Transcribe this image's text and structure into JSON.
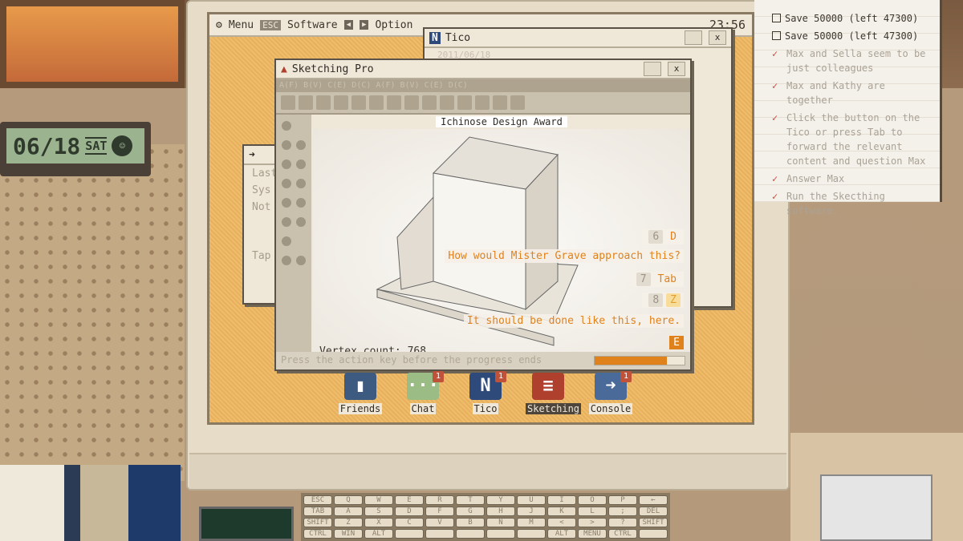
{
  "clock": {
    "date": "06/18",
    "day": "SAT"
  },
  "menubar": {
    "menu": "Menu",
    "menu_key": "ESC",
    "software": "Software",
    "option": "Option",
    "time": "23:56"
  },
  "tico": {
    "title": "Tico",
    "date": "2011/06/18"
  },
  "background_window": {
    "lines": [
      "Last",
      "Sys",
      "Not",
      "Tap"
    ]
  },
  "sketch": {
    "title": "Sketching Pro",
    "menu": "A(F) B(V) C(E) D(C) A(F) B(V) C(E) D(C)",
    "doc_title": "Ichinose Design Award",
    "vertex_label": "Vertex count:",
    "vertex_count": "768",
    "options": [
      {
        "num": "6",
        "key": "D",
        "text": "How would Mister Grave approach this?"
      },
      {
        "num": "7",
        "key": "Tab"
      },
      {
        "num": "8",
        "key": "Z",
        "text": "It should be done like this, here."
      },
      {
        "key": "E"
      }
    ],
    "status": "Press the action key before the progress ends",
    "progress_percent": 80,
    "accent": "#e0821c"
  },
  "taskbar": [
    {
      "label": "Friends",
      "icon": "friends-icon",
      "badge": null
    },
    {
      "label": "Chat",
      "icon": "chat-icon",
      "badge": "1"
    },
    {
      "label": "Tico",
      "icon": "tico-icon",
      "badge": "1"
    },
    {
      "label": "Sketching",
      "icon": "sketching-icon",
      "badge": null,
      "active": true
    },
    {
      "label": "Console",
      "icon": "console-icon",
      "badge": "1"
    }
  ],
  "notepad": {
    "tasks": [
      {
        "text": "Save 50000 (left 47300)",
        "done": false
      },
      {
        "text": "Save 50000 (left 47300)",
        "done": false
      },
      {
        "text": "Max and Sella seem to be just colleagues",
        "done": true
      },
      {
        "text": "Max and Kathy are together",
        "done": true
      },
      {
        "text": "Click the button on the Tico or press Tab to forward the relevant content and question Max",
        "done": true
      },
      {
        "text": "Answer Max",
        "done": true
      },
      {
        "text": "Run the Skecthing software.",
        "done": true
      }
    ]
  },
  "keyboard": [
    "ESC",
    "Q",
    "W",
    "E",
    "R",
    "T",
    "Y",
    "U",
    "I",
    "O",
    "P",
    "←",
    "TAB",
    "A",
    "S",
    "D",
    "F",
    "G",
    "H",
    "J",
    "K",
    "L",
    ";",
    "DEL",
    "SHIFT",
    "Z",
    "X",
    "C",
    "V",
    "B",
    "N",
    "M",
    "<",
    ">",
    "?",
    "SHIFT",
    "CTRL",
    "WIN",
    "ALT",
    "",
    "",
    "",
    "",
    "",
    "ALT",
    "MENU",
    "CTRL",
    ""
  ]
}
